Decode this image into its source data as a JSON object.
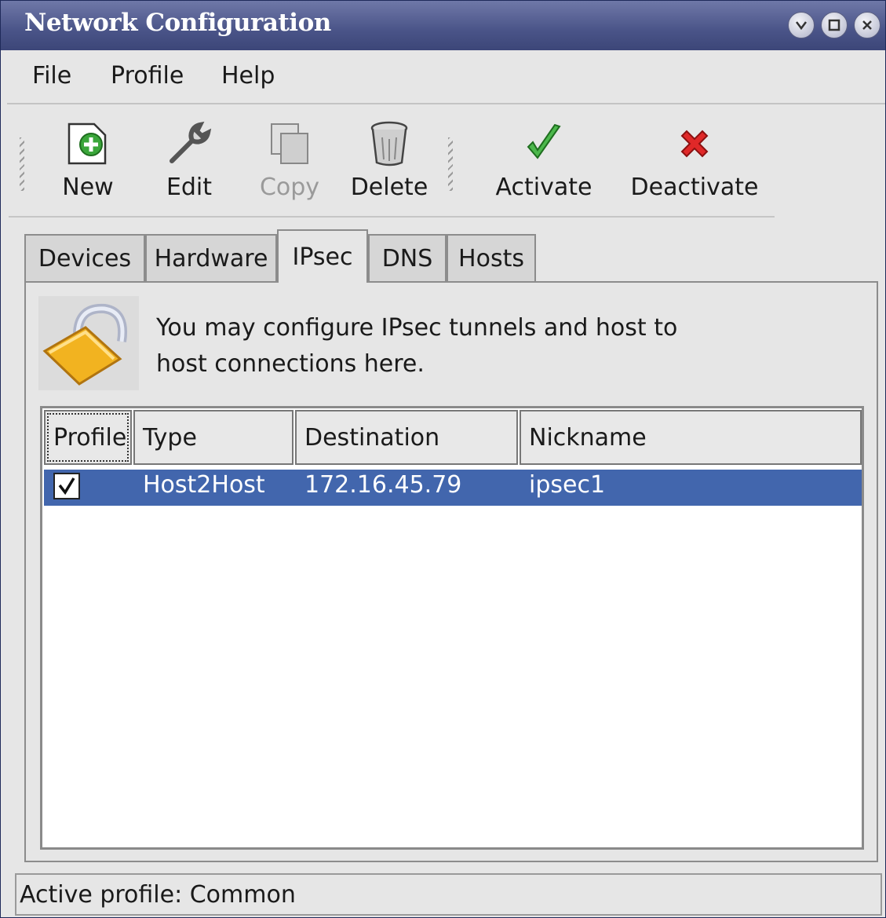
{
  "window": {
    "title": "Network Configuration"
  },
  "menubar": {
    "items": [
      "File",
      "Profile",
      "Help"
    ]
  },
  "toolbar": {
    "new": "New",
    "edit": "Edit",
    "copy": "Copy",
    "delete": "Delete",
    "activate": "Activate",
    "deactivate": "Deactivate",
    "icons": [
      "new-icon",
      "edit-icon",
      "copy-icon",
      "delete-icon",
      "activate-icon",
      "deactivate-icon"
    ]
  },
  "tabs": [
    "Devices",
    "Hardware",
    "IPsec",
    "DNS",
    "Hosts"
  ],
  "active_tab": "IPsec",
  "ipsec": {
    "info_line1": "You may configure IPsec tunnels and host to",
    "info_line2": "host connections here.",
    "columns": [
      "Profile",
      "Type",
      "Destination",
      "Nickname"
    ],
    "rows": [
      {
        "profile_checked": true,
        "type": "Host2Host",
        "destination": "172.16.45.79",
        "nickname": "ipsec1"
      }
    ]
  },
  "status": {
    "text": "Active profile: Common"
  },
  "colors": {
    "titlebar": "#4a5488",
    "selection": "#4266ad",
    "window_bg": "#e6e6e6"
  }
}
